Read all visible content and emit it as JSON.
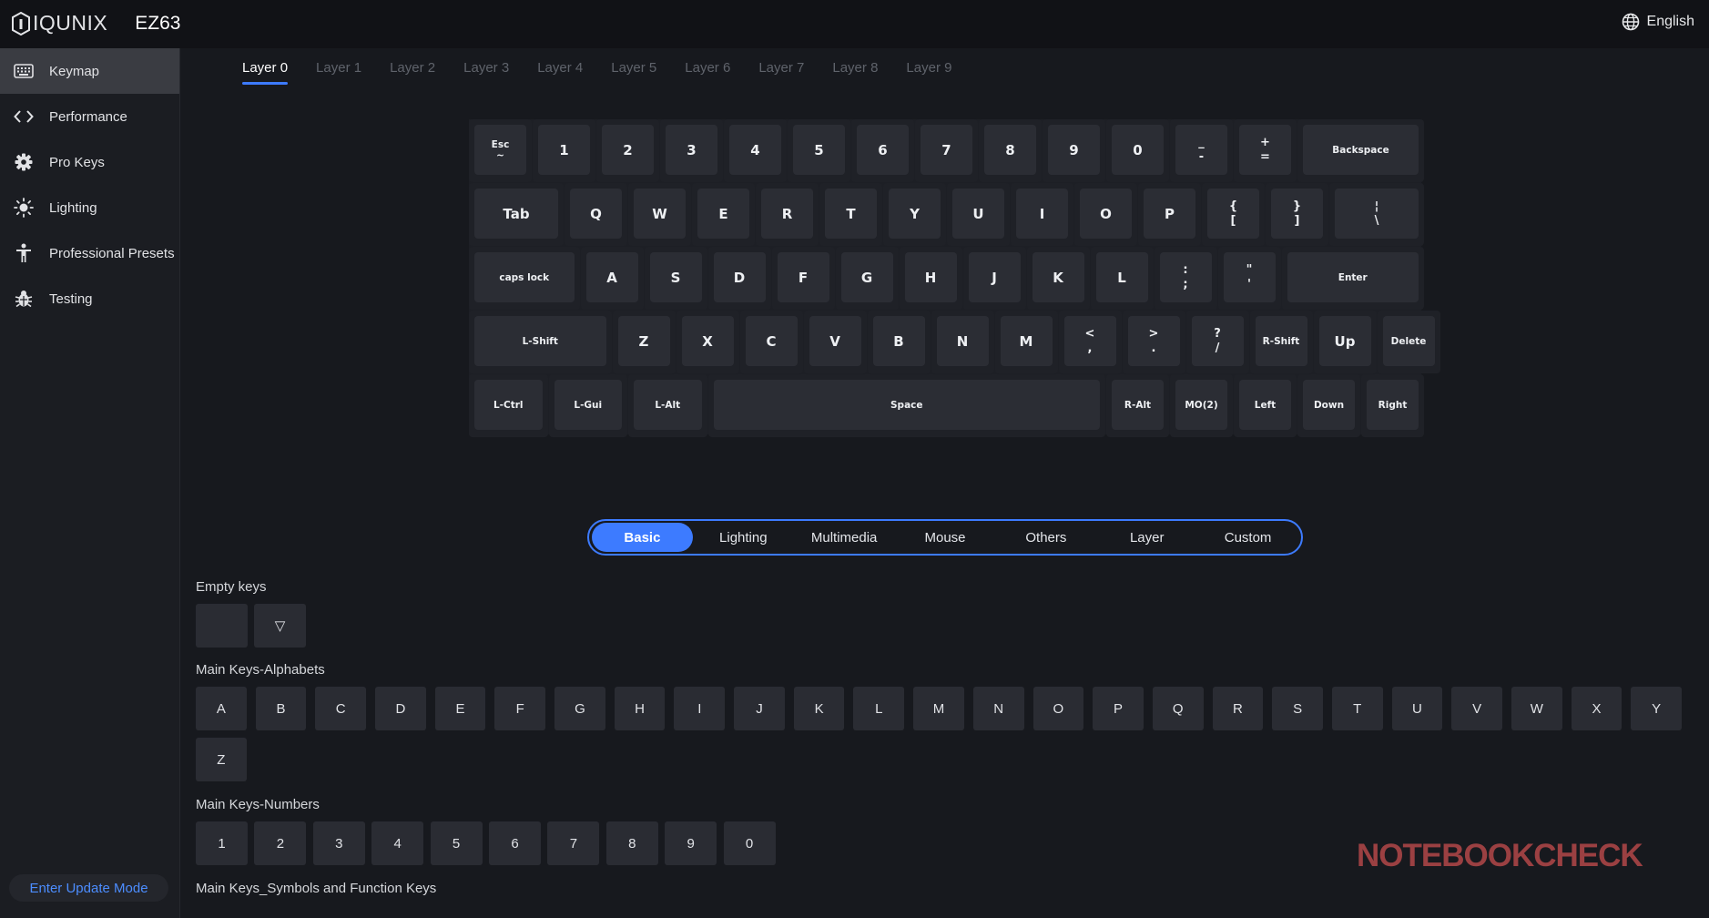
{
  "app": {
    "brand": "IQUNIX",
    "model": "EZ63",
    "language": "English"
  },
  "sidebar": {
    "items": [
      {
        "label": "Keymap",
        "icon": "keyboard-icon"
      },
      {
        "label": "Performance",
        "icon": "code-icon"
      },
      {
        "label": "Pro Keys",
        "icon": "gear-icon"
      },
      {
        "label": "Lighting",
        "icon": "sun-icon"
      },
      {
        "label": "Professional Presets",
        "icon": "person-icon"
      },
      {
        "label": "Testing",
        "icon": "bug-icon"
      }
    ],
    "update_button": "Enter Update Mode"
  },
  "layers": [
    "Layer 0",
    "Layer 1",
    "Layer 2",
    "Layer 3",
    "Layer 4",
    "Layer 5",
    "Layer 6",
    "Layer 7",
    "Layer 8",
    "Layer 9"
  ],
  "keyboard": {
    "rows": [
      [
        {
          "t": "Esc",
          "b": "~",
          "s": 1
        },
        {
          "t": "1"
        },
        {
          "t": "2"
        },
        {
          "t": "3"
        },
        {
          "t": "4"
        },
        {
          "t": "5"
        },
        {
          "t": "6"
        },
        {
          "t": "7"
        },
        {
          "t": "8"
        },
        {
          "t": "9"
        },
        {
          "t": "0"
        },
        {
          "t": "_",
          "b": "-"
        },
        {
          "t": "+",
          "b": "="
        },
        {
          "t": "Backspace",
          "s": 1
        }
      ],
      [
        {
          "t": "Tab"
        },
        {
          "t": "Q"
        },
        {
          "t": "W"
        },
        {
          "t": "E"
        },
        {
          "t": "R"
        },
        {
          "t": "T"
        },
        {
          "t": "Y"
        },
        {
          "t": "U"
        },
        {
          "t": "I"
        },
        {
          "t": "O"
        },
        {
          "t": "P"
        },
        {
          "t": "{",
          "b": "["
        },
        {
          "t": "}",
          "b": "]"
        },
        {
          "t": "¦",
          "b": "\\"
        }
      ],
      [
        {
          "t": "caps lock",
          "s": 1
        },
        {
          "t": "A"
        },
        {
          "t": "S"
        },
        {
          "t": "D"
        },
        {
          "t": "F"
        },
        {
          "t": "G"
        },
        {
          "t": "H"
        },
        {
          "t": "J"
        },
        {
          "t": "K"
        },
        {
          "t": "L"
        },
        {
          "t": ":",
          "b": ";"
        },
        {
          "t": "\"",
          "b": "'"
        },
        {
          "t": "Enter",
          "s": 1
        }
      ],
      [
        {
          "t": "L-Shift",
          "s": 1
        },
        {
          "t": "Z"
        },
        {
          "t": "X"
        },
        {
          "t": "C"
        },
        {
          "t": "V"
        },
        {
          "t": "B"
        },
        {
          "t": "N"
        },
        {
          "t": "M"
        },
        {
          "t": "<",
          "b": ","
        },
        {
          "t": ">",
          "b": "."
        },
        {
          "t": "?",
          "b": "/"
        },
        {
          "t": "R-Shift",
          "s": 1
        },
        {
          "t": "Up"
        },
        {
          "t": "Delete",
          "s": 1
        }
      ],
      [
        {
          "t": "L-Ctrl",
          "s": 1
        },
        {
          "t": "L-Gui",
          "s": 1
        },
        {
          "t": "L-Alt",
          "s": 1
        },
        {
          "t": "Space",
          "s": 1
        },
        {
          "t": "R-Alt",
          "s": 1
        },
        {
          "t": "MO(2)",
          "s": 1
        },
        {
          "t": "Left",
          "s": 1
        },
        {
          "t": "Down",
          "s": 1
        },
        {
          "t": "Right",
          "s": 1
        }
      ]
    ]
  },
  "categories": [
    "Basic",
    "Lighting",
    "Multimedia",
    "Mouse",
    "Others",
    "Layer",
    "Custom"
  ],
  "sections": {
    "empty_title": "Empty keys",
    "empty_keys": [
      "",
      "▽"
    ],
    "alpha_title": "Main Keys-Alphabets",
    "alphabets": [
      "A",
      "B",
      "C",
      "D",
      "E",
      "F",
      "G",
      "H",
      "I",
      "J",
      "K",
      "L",
      "M",
      "N",
      "O",
      "P",
      "Q",
      "R",
      "S",
      "T",
      "U",
      "V",
      "W",
      "X",
      "Y",
      "Z"
    ],
    "numbers_title": "Main Keys-Numbers",
    "numbers": [
      "1",
      "2",
      "3",
      "4",
      "5",
      "6",
      "7",
      "8",
      "9",
      "0"
    ],
    "symbols_title": "Main Keys_Symbols and Function Keys"
  },
  "watermark": "NOTEBOOKCHECK"
}
